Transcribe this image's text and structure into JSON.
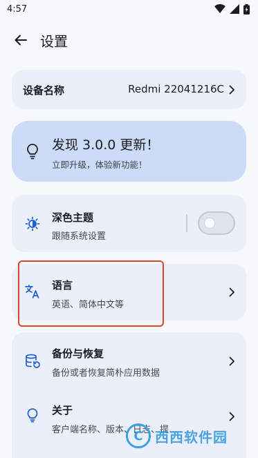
{
  "status_bar": {
    "time": "4:57"
  },
  "app_bar": {
    "title": "设置"
  },
  "device": {
    "label": "设备名称",
    "value": "Redmi 22041216C"
  },
  "update": {
    "title": "发现 3.0.0 更新！",
    "subtitle": "立即升级，体验新功能！"
  },
  "theme": {
    "title": "深色主题",
    "subtitle": "跟随系统设置",
    "enabled": false
  },
  "language": {
    "title": "语言",
    "subtitle": "英语、简体中文等"
  },
  "backup": {
    "title": "备份与恢复",
    "subtitle": "备份或者恢复简朴应用数据"
  },
  "about": {
    "title": "关于",
    "subtitle": "客户端名称、版本、日志、提… "
  },
  "watermark": {
    "text": "西西软件园",
    "logo_letter": "C"
  },
  "colors": {
    "background": "#f7f8fc",
    "card": "#eaeffa",
    "update_card": "#cddcf6",
    "icon_accent": "#1f5fd1",
    "highlight": "#d9442c"
  }
}
